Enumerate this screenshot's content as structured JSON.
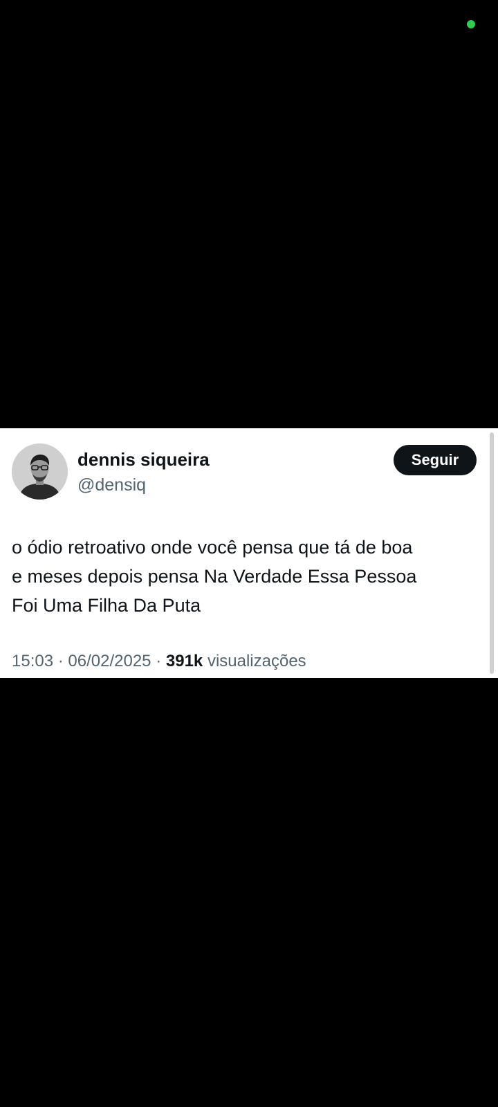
{
  "colors": {
    "background": "#000000",
    "card": "#ffffff",
    "text_primary": "#0f1419",
    "text_secondary": "#536471",
    "privacy_indicator": "#2ecc52",
    "button_bg": "#0f1419",
    "button_text": "#ffffff"
  },
  "tweet": {
    "author": {
      "display_name": "dennis siqueira",
      "handle": "@densiq",
      "avatar_icon": "profile-photo"
    },
    "follow_label": "Seguir",
    "text_lines": [
      "o ódio retroativo onde você pensa que tá de boa",
      "e meses depois pensa Na Verdade Essa Pessoa",
      "Foi Uma Filha Da Puta"
    ],
    "time": "15:03",
    "separator": "·",
    "date": "06/02/2025",
    "views_count": "391k",
    "views_label": "visualizações"
  }
}
